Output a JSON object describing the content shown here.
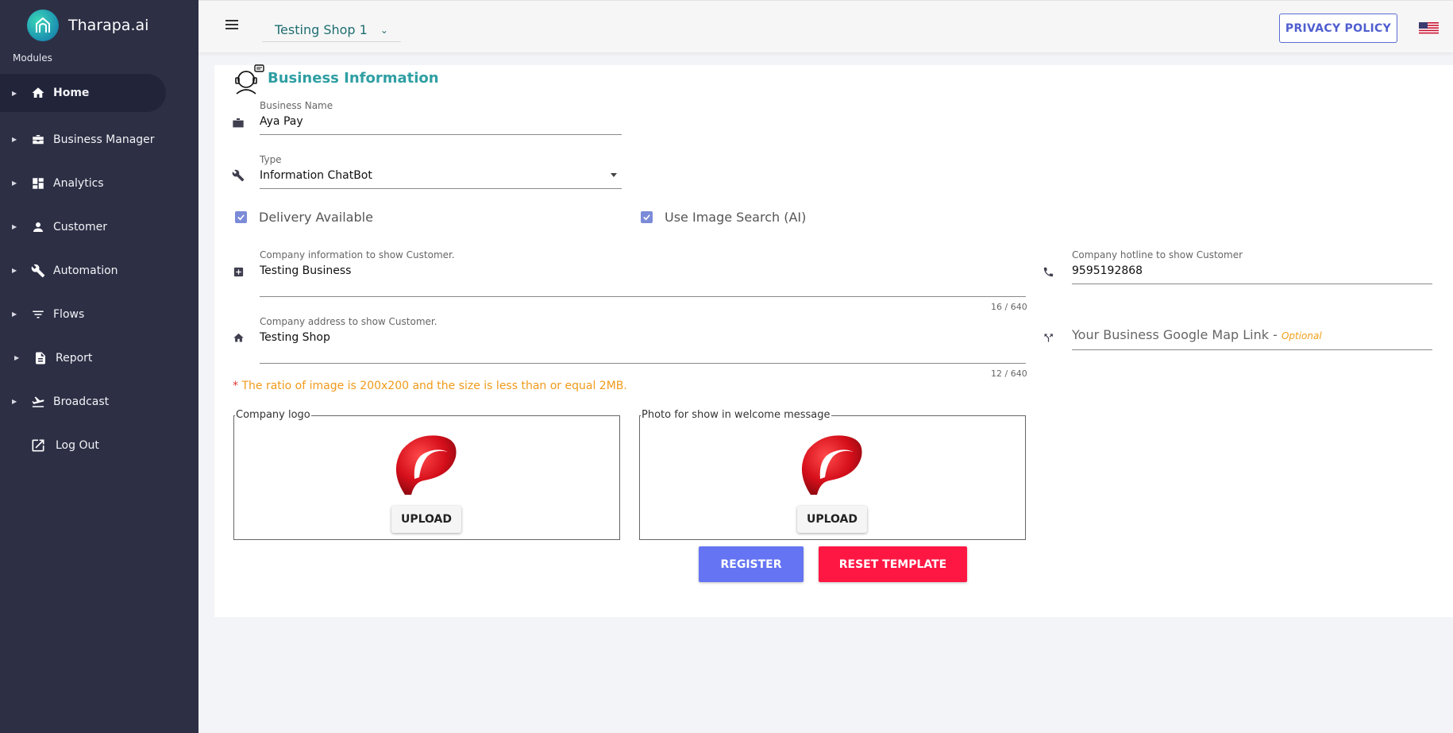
{
  "sidebar": {
    "brand": "Tharapa.ai",
    "modules_label": "Modules",
    "items": [
      {
        "label": "Home",
        "icon": "home-icon"
      },
      {
        "label": "Business Manager",
        "icon": "briefcase-icon"
      },
      {
        "label": "Analytics",
        "icon": "dashboard-icon"
      },
      {
        "label": "Customer",
        "icon": "person-icon"
      },
      {
        "label": "Automation",
        "icon": "wrench-icon"
      },
      {
        "label": "Flows",
        "icon": "filter-icon"
      },
      {
        "label": "Report",
        "icon": "document-icon"
      },
      {
        "label": "Broadcast",
        "icon": "flight-takeoff-icon"
      },
      {
        "label": "Log Out",
        "icon": "open-in-new-icon"
      }
    ]
  },
  "topbar": {
    "shop": "Testing Shop 1",
    "privacy": "PRIVACY POLICY"
  },
  "form": {
    "title": "Business Information",
    "business_name_label": "Business Name",
    "business_name": "Aya Pay",
    "type_label": "Type",
    "type_value": "Information ChatBot",
    "delivery_label": "Delivery Available",
    "image_search_label": "Use Image Search (AI)",
    "company_info_label": "Company information to show Customer.",
    "company_info": "Testing Business",
    "company_info_counter": "16 / 640",
    "hotline_label": "Company hotline to show Customer",
    "hotline": "9595192868",
    "address_label": "Company address to show Customer.",
    "address": "Testing Shop",
    "address_counter": "12 / 640",
    "map_placeholder": "Your Business Google Map Link - ",
    "map_optional": "Optional",
    "note_star": "*",
    "note": " The ratio of image is 200x200 and the size is less than or equal 2MB.",
    "logo_legend": "Company logo",
    "welcome_legend": "Photo for show in welcome message",
    "upload": "UPLOAD",
    "register": "REGISTER",
    "reset": "RESET TEMPLATE"
  },
  "colors": {
    "sidebar_bg": "#2d2f45",
    "accent_teal": "#2f9fa3",
    "primary": "#6574f2",
    "danger": "#ff1744",
    "warning": "#f09a1a"
  }
}
